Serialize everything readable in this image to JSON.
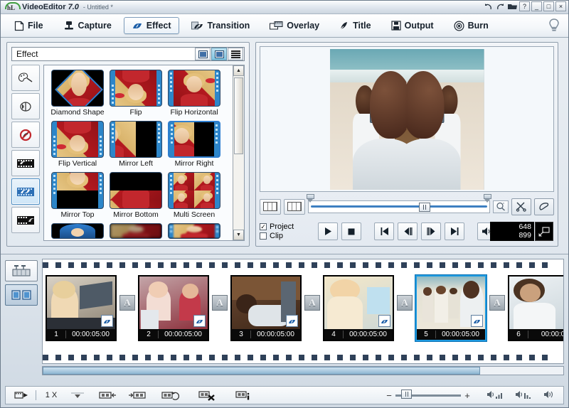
{
  "window": {
    "app_name": "VideoEditor",
    "version": "7.0",
    "document": "- Untitled *",
    "logo_text": "hL",
    "controls": {
      "undo": "undo-arrow",
      "redo": "redo-arrow",
      "open": "folder",
      "help": "?",
      "minimize": "_",
      "maximize": "□",
      "close": "×"
    }
  },
  "menubar": {
    "items": [
      {
        "label": "File",
        "icon": "page-icon",
        "active": false
      },
      {
        "label": "Capture",
        "icon": "capture-icon",
        "active": false
      },
      {
        "label": "Effect",
        "icon": "effect-swirl-icon",
        "active": true
      },
      {
        "label": "Transition",
        "icon": "transition-icon",
        "active": false
      },
      {
        "label": "Overlay",
        "icon": "overlay-icon",
        "active": false
      },
      {
        "label": "Title",
        "icon": "title-pen-icon",
        "active": false
      },
      {
        "label": "Output",
        "icon": "floppy-icon",
        "active": false
      },
      {
        "label": "Burn",
        "icon": "disc-icon",
        "active": false
      }
    ],
    "hint_icon": "lightbulb-icon"
  },
  "effect_panel": {
    "title": "Effect",
    "view_modes": [
      {
        "name": "thumbnail-small-view",
        "selected": false
      },
      {
        "name": "thumbnail-large-view",
        "selected": true
      },
      {
        "name": "list-view",
        "selected": false
      }
    ],
    "categories": [
      {
        "name": "color-palette-category",
        "selected": false
      },
      {
        "name": "film-roll-category",
        "selected": false
      },
      {
        "name": "no-effect-category",
        "selected": false
      },
      {
        "name": "filmstrip-in-category",
        "selected": false
      },
      {
        "name": "filmstrip-effect-category",
        "selected": true
      },
      {
        "name": "filmstrip-out-category",
        "selected": false
      }
    ],
    "effects": [
      {
        "label": "Diamond Shape",
        "style": "diamond",
        "selected": false
      },
      {
        "label": "Flip",
        "style": "flip",
        "selected": false
      },
      {
        "label": "Flip Horizontal",
        "style": "fliph",
        "selected": false
      },
      {
        "label": "Flip Vertical",
        "style": "flipv",
        "selected": false
      },
      {
        "label": "Mirror Left",
        "style": "mirrorleft",
        "selected": false
      },
      {
        "label": "Mirror Right",
        "style": "mirrorright",
        "selected": true
      },
      {
        "label": "Mirror Top",
        "style": "mirrortop",
        "selected": false
      },
      {
        "label": "Mirror Bottom",
        "style": "mirrorbottom",
        "selected": false
      },
      {
        "label": "Multi Screen",
        "style": "multiscreen",
        "selected": false
      },
      {
        "label": "",
        "style": "partial1",
        "selected": false
      },
      {
        "label": "",
        "style": "partial2",
        "selected": false
      },
      {
        "label": "",
        "style": "partial3",
        "selected": false
      }
    ]
  },
  "preview": {
    "source_mode": {
      "project_label": "Project",
      "project_checked": true,
      "clip_label": "Clip",
      "clip_checked": false
    },
    "trim_buttons": [
      {
        "name": "mark-in-button"
      },
      {
        "name": "mark-out-button"
      }
    ],
    "right_tools": [
      {
        "name": "cut-scissors-button"
      },
      {
        "name": "eraser-button"
      }
    ],
    "zoom_button": "magnifier-button",
    "transport": [
      {
        "name": "play-button",
        "glyph": "play"
      },
      {
        "name": "stop-button",
        "glyph": "stop"
      },
      {
        "name": "previous-button",
        "glyph": "prev"
      },
      {
        "name": "step-back-button",
        "glyph": "stepback"
      },
      {
        "name": "step-forward-button",
        "glyph": "stepfwd"
      },
      {
        "name": "next-button",
        "glyph": "next"
      },
      {
        "name": "volume-button",
        "glyph": "volume"
      }
    ],
    "counter": {
      "current": "648",
      "total": "899"
    },
    "fullscreen_button": "fullscreen-icon"
  },
  "storyboard": {
    "modes": [
      {
        "name": "timeline-view-button",
        "selected": false
      },
      {
        "name": "storyboard-view-button",
        "selected": true
      }
    ],
    "transition_label": "A",
    "clips": [
      {
        "number": "1",
        "duration": "00:00:05:00",
        "selected": false,
        "scene": "woman-laptop"
      },
      {
        "number": "2",
        "duration": "00:00:05:00",
        "selected": false,
        "scene": "mother-daughter"
      },
      {
        "number": "3",
        "duration": "00:00:05:00",
        "selected": false,
        "scene": "boy-couch"
      },
      {
        "number": "4",
        "duration": "00:00:05:00",
        "selected": false,
        "scene": "girl-painting"
      },
      {
        "number": "5",
        "duration": "00:00:05:00",
        "selected": true,
        "scene": "beach-family"
      },
      {
        "number": "6",
        "duration": "00:00:0",
        "selected": false,
        "scene": "woman-smiling"
      }
    ]
  },
  "bottom_toolbar": {
    "buttons": [
      {
        "name": "add-clip-button"
      },
      {
        "name": "multiplier-dropdown-button"
      },
      {
        "name": "move-left-button"
      },
      {
        "name": "move-right-button"
      },
      {
        "name": "rotate-button"
      },
      {
        "name": "delete-clip-button"
      },
      {
        "name": "clip-info-button"
      }
    ],
    "multiplier": "1 X",
    "zoom_minus": "−",
    "zoom_plus": "+",
    "volume_icons": [
      {
        "name": "volume-up-icon"
      },
      {
        "name": "volume-down-icon"
      },
      {
        "name": "volume-mute-icon"
      }
    ]
  },
  "colors": {
    "accent_blue": "#2f7fd0",
    "selection_blue": "#1e9ae0",
    "toolbar_bg": "#f4f7fa",
    "panel_bg": "#e4eaf1",
    "lower_bg": "#cfd9e3"
  }
}
